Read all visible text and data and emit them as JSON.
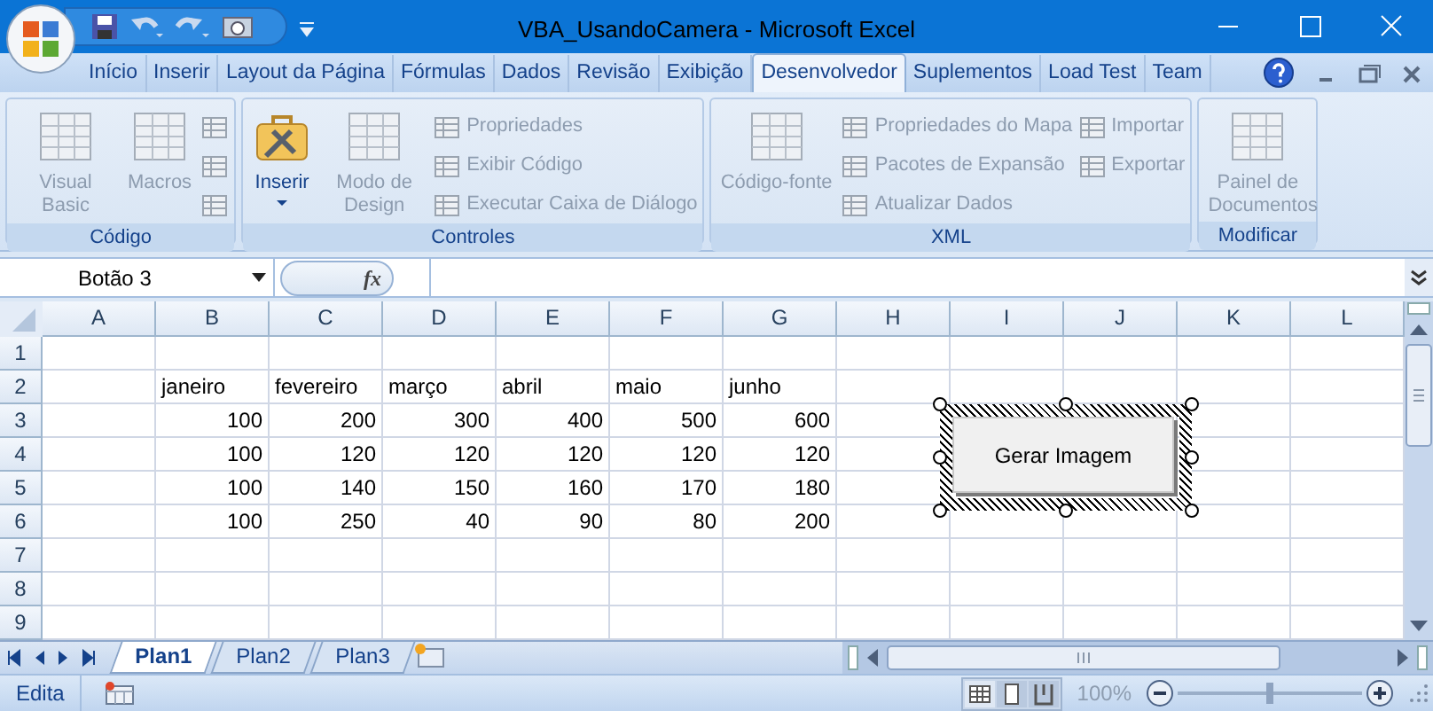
{
  "title_bar": {
    "title": "VBA_UsandoCamera - Microsoft Excel"
  },
  "ribbon_tabs": [
    {
      "label": "Início",
      "selected": false
    },
    {
      "label": "Inserir",
      "selected": false
    },
    {
      "label": "Layout da Página",
      "selected": false
    },
    {
      "label": "Fórmulas",
      "selected": false
    },
    {
      "label": "Dados",
      "selected": false
    },
    {
      "label": "Revisão",
      "selected": false
    },
    {
      "label": "Exibição",
      "selected": false
    },
    {
      "label": "Desenvolvedor",
      "selected": true
    },
    {
      "label": "Suplementos",
      "selected": false
    },
    {
      "label": "Load Test",
      "selected": false
    },
    {
      "label": "Team",
      "selected": false
    }
  ],
  "ribbon_groups": [
    {
      "title": "Código",
      "items": [
        {
          "kind": "large",
          "label": "Visual Basic",
          "disabled": true
        },
        {
          "kind": "large",
          "label": "Macros",
          "disabled": true
        },
        {
          "kind": "small",
          "disabled": true
        },
        {
          "kind": "small",
          "disabled": true
        },
        {
          "kind": "small",
          "disabled": true
        }
      ]
    },
    {
      "title": "Controles",
      "items": [
        {
          "kind": "large",
          "label": "Inserir",
          "disabled": false,
          "dropdown": true
        },
        {
          "kind": "large",
          "label": "Modo de Design",
          "disabled": true
        },
        {
          "kind": "small",
          "label": "Propriedades",
          "disabled": true
        },
        {
          "kind": "small",
          "label": "Exibir Código",
          "disabled": true
        },
        {
          "kind": "small",
          "label": "Executar Caixa de Diálogo",
          "disabled": true
        }
      ]
    },
    {
      "title": "XML",
      "items": [
        {
          "kind": "large",
          "label": "Código-fonte",
          "disabled": true
        },
        {
          "kind": "small",
          "label": "Propriedades do Mapa",
          "disabled": true
        },
        {
          "kind": "small",
          "label": "Pacotes de Expansão",
          "disabled": true
        },
        {
          "kind": "small",
          "label": "Atualizar Dados",
          "disabled": true
        },
        {
          "kind": "small",
          "label": "Importar",
          "disabled": true
        },
        {
          "kind": "small",
          "label": "Exportar",
          "disabled": true
        }
      ]
    },
    {
      "title": "Modificar",
      "items": [
        {
          "kind": "large",
          "label": "Painel de Documentos",
          "disabled": true
        }
      ]
    }
  ],
  "formula_bar": {
    "name_box": "Botão 3",
    "function_label": "fx"
  },
  "sheet": {
    "columns": [
      "A",
      "B",
      "C",
      "D",
      "E",
      "F",
      "G",
      "H",
      "I",
      "J",
      "K",
      "L"
    ],
    "rows": [
      {
        "label": "1"
      },
      {
        "label": "2",
        "kind": "text",
        "cells": [
          null,
          "janeiro",
          "fevereiro",
          "março",
          "abril",
          "maio",
          "junho"
        ]
      },
      {
        "label": "3",
        "kind": "number",
        "cells": [
          null,
          "100",
          "200",
          "300",
          "400",
          "500",
          "600"
        ]
      },
      {
        "label": "4",
        "kind": "number",
        "cells": [
          null,
          "100",
          "120",
          "120",
          "120",
          "120",
          "120"
        ]
      },
      {
        "label": "5",
        "kind": "number",
        "cells": [
          null,
          "100",
          "140",
          "150",
          "160",
          "170",
          "180"
        ]
      },
      {
        "label": "6",
        "kind": "number",
        "cells": [
          null,
          "100",
          "250",
          "40",
          "90",
          "80",
          "200"
        ]
      },
      {
        "label": "7"
      },
      {
        "label": "8"
      },
      {
        "label": "9"
      }
    ]
  },
  "form_button": {
    "label": "Gerar Imagem",
    "selected": true
  },
  "sheet_tabs": [
    {
      "label": "Plan1",
      "selected": true
    },
    {
      "label": "Plan2",
      "selected": false
    },
    {
      "label": "Plan3",
      "selected": false
    }
  ],
  "status_bar": {
    "mode": "Edita",
    "zoom": "100%",
    "zoom_slider": {
      "level": 0.5
    }
  }
}
